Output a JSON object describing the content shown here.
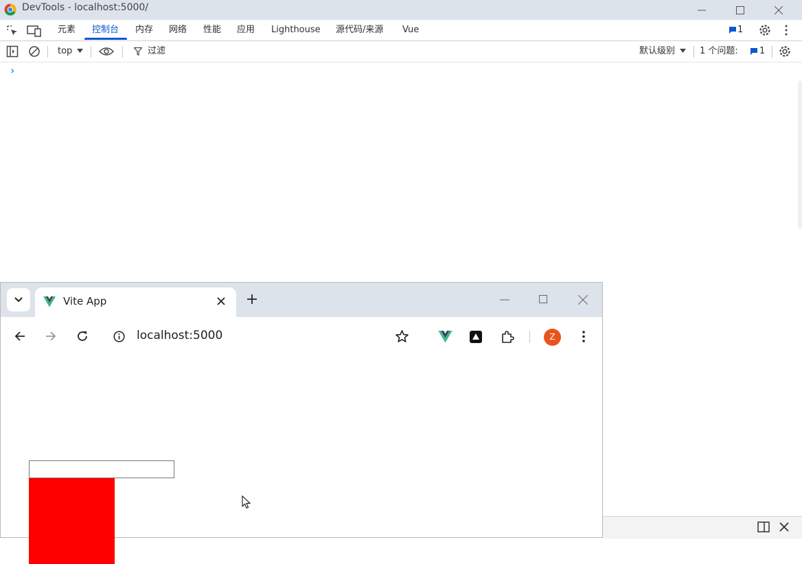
{
  "devtools": {
    "window_title": "DevTools - localhost:5000/",
    "tabs": [
      "元素",
      "控制台",
      "内存",
      "网络",
      "性能",
      "应用",
      "Lighthouse",
      "源代码/来源",
      "Vue"
    ],
    "active_tab": "控制台",
    "issues_badge": "1",
    "console_toolbar": {
      "context": "top",
      "filter_label": "过滤",
      "levels_label": "默认级别",
      "issues_label": "1 个问题:",
      "issues_count": "1"
    },
    "prompt_symbol": "›"
  },
  "browser": {
    "tab_title": "Vite App",
    "url": "localhost:5000",
    "profile_initial": "Z",
    "profile_color": "#e8541c"
  },
  "page": {
    "input_value": "",
    "box_color": "#ff0000"
  },
  "colors": {
    "accent": "#0b57d0",
    "vue_green": "#41b883",
    "vue_dark": "#35495e"
  }
}
